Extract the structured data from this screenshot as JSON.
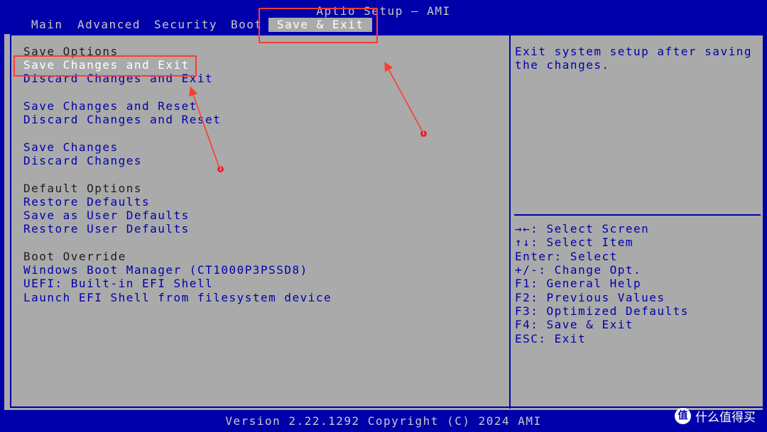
{
  "header": {
    "title": "Aptio Setup – AMI",
    "tabs": [
      {
        "label": "Main"
      },
      {
        "label": "Advanced"
      },
      {
        "label": "Security"
      },
      {
        "label": "Boot"
      },
      {
        "label": "Save & Exit"
      }
    ]
  },
  "menu": {
    "save_options_heading": "Save Options",
    "save_changes_and_exit": "Save Changes and Exit",
    "discard_changes_and_exit": "Discard Changes and Exit",
    "save_changes_and_reset": "Save Changes and Reset",
    "discard_changes_and_reset": "Discard Changes and Reset",
    "save_changes": "Save Changes",
    "discard_changes": "Discard Changes",
    "default_options_heading": "Default Options",
    "restore_defaults": "Restore Defaults",
    "save_as_user_defaults": "Save as User Defaults",
    "restore_user_defaults": "Restore User Defaults",
    "boot_override_heading": "Boot Override",
    "boot_windows": "Windows Boot Manager (CT1000P3PSSD8)",
    "boot_uefi_shell": "UEFI: Built-in EFI Shell",
    "boot_launch_efi": "Launch EFI Shell from filesystem device"
  },
  "help": {
    "description": "Exit system setup after saving\nthe changes.",
    "keys": [
      "→←: Select Screen",
      "↑↓: Select Item",
      "Enter: Select",
      "+/-: Change Opt.",
      "F1: General Help",
      "F2: Previous Values",
      "F3: Optimized Defaults",
      "F4: Save & Exit",
      "ESC: Exit"
    ]
  },
  "footer": {
    "version": "Version 2.22.1292 Copyright (C) 2024 AMI"
  },
  "annotations": {
    "marker_1": "1",
    "marker_2": "2",
    "color": "#FF3B30"
  },
  "watermark": {
    "logo": "值",
    "text": "什么值得买"
  },
  "colors": {
    "bios_blue": "#0000AA",
    "panel_gray": "#AAAAAA",
    "highlight_white": "#FFFFFF"
  }
}
